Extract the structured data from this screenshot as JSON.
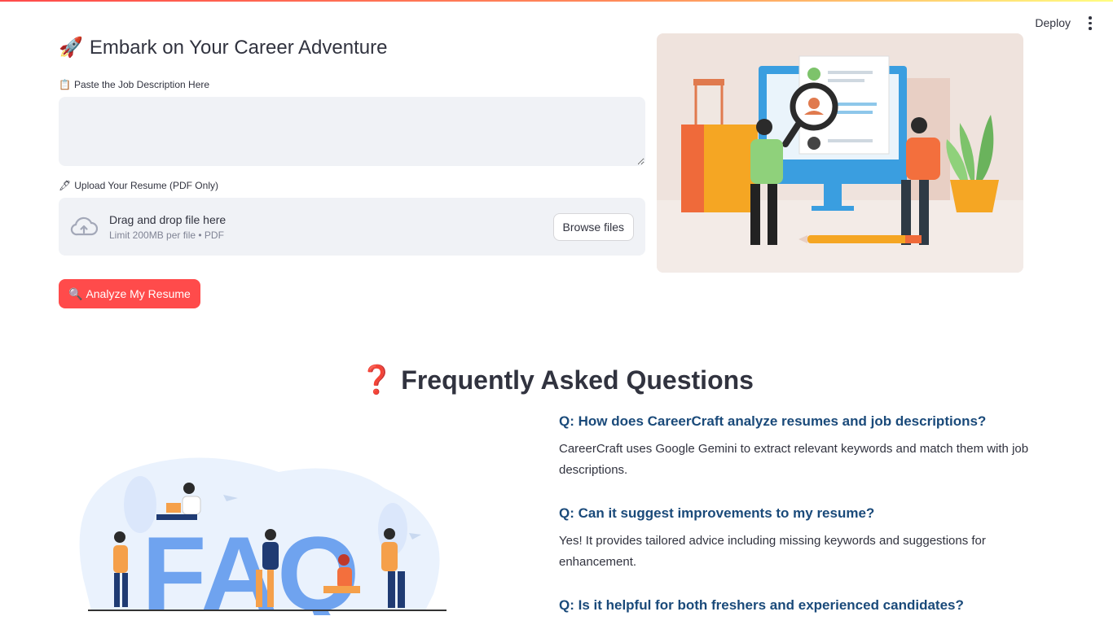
{
  "header": {
    "deploy_label": "Deploy"
  },
  "main": {
    "title_icon": "🚀",
    "title": "Embark on Your Career Adventure",
    "jd_label_icon": "📋",
    "jd_label": "Paste the Job Description Here",
    "jd_value": "",
    "resume_label_icon": "🖋",
    "resume_label": "Upload Your Resume (PDF Only)",
    "dropzone_title": "Drag and drop file here",
    "dropzone_limit": "Limit 200MB per file • PDF",
    "browse_label": "Browse files",
    "analyze_icon": "🔍",
    "analyze_label": "Analyze My Resume"
  },
  "faq": {
    "title_icon": "❓",
    "title": "Frequently Asked Questions",
    "illustration_letters": "FAQ",
    "items": [
      {
        "q": "Q: How does CareerCraft analyze resumes and job descriptions?",
        "a": "CareerCraft uses Google Gemini to extract relevant keywords and match them with job descriptions."
      },
      {
        "q": "Q: Can it suggest improvements to my resume?",
        "a": "Yes! It provides tailored advice including missing keywords and suggestions for enhancement."
      },
      {
        "q": "Q: Is it helpful for both freshers and experienced candidates?",
        "a": ""
      }
    ]
  },
  "colors": {
    "primary": "#ff4b4b",
    "faq_question": "#1a4a7a",
    "input_bg": "#f0f2f6"
  }
}
